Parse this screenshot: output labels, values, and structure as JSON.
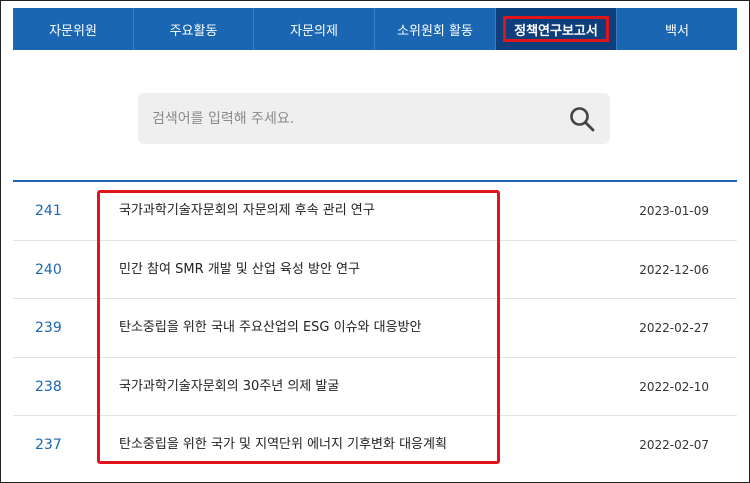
{
  "nav": {
    "items": [
      {
        "label": "자문위원"
      },
      {
        "label": "주요활동"
      },
      {
        "label": "자문의제"
      },
      {
        "label": "소위원회 활동"
      },
      {
        "label": "정책연구보고서"
      },
      {
        "label": "백서"
      }
    ]
  },
  "search": {
    "placeholder": "검색어를 입력해 주세요."
  },
  "reports": [
    {
      "num": "241",
      "title": "국가과학기술자문회의 자문의제 후속 관리 연구",
      "date": "2023-01-09"
    },
    {
      "num": "240",
      "title": "민간 참여 SMR 개발 및 산업 육성 방안 연구",
      "date": "2022-12-06"
    },
    {
      "num": "239",
      "title": "탄소중립을 위한 국내 주요산업의 ESG 이슈와 대응방안",
      "date": "2022-02-27"
    },
    {
      "num": "238",
      "title": "국가과학기술자문회의 30주년 의제 발굴",
      "date": "2022-02-10"
    },
    {
      "num": "237",
      "title": "탄소중립을 위한 국가 및 지역단위 에너지 기후변화 대응계획",
      "date": "2022-02-07"
    }
  ],
  "colors": {
    "nav_bg": "#1a66b3",
    "nav_active": "#0e3f7c",
    "highlight": "#e0141b",
    "number": "#1a66b3"
  }
}
